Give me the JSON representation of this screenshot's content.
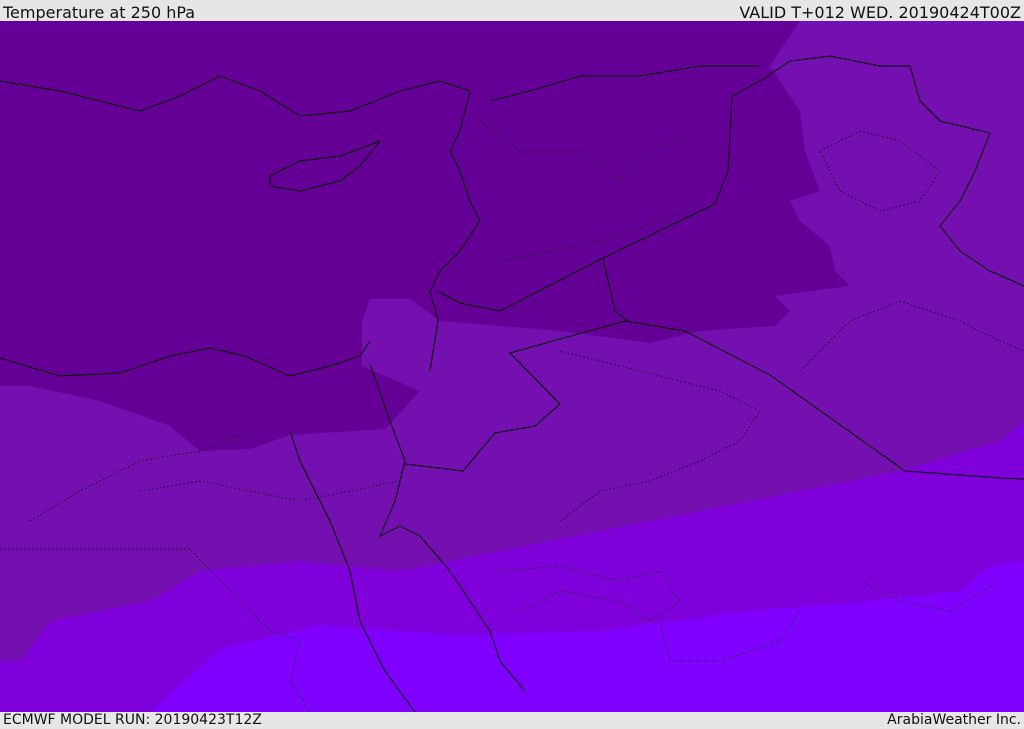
{
  "header": {
    "title": "Temperature at 250 hPa",
    "valid": "VALID T+012 WED. 20190424T00Z"
  },
  "footer": {
    "model_run": "ECMWF MODEL RUN: 20190423T12Z",
    "credit": "ArabiaWeather Inc."
  },
  "map": {
    "variable": "temperature",
    "level": "250 hPa",
    "band_colors": [
      "#650096",
      "#7510b0",
      "#7f00db",
      "#7f00ff"
    ],
    "border_color": "#000000"
  }
}
